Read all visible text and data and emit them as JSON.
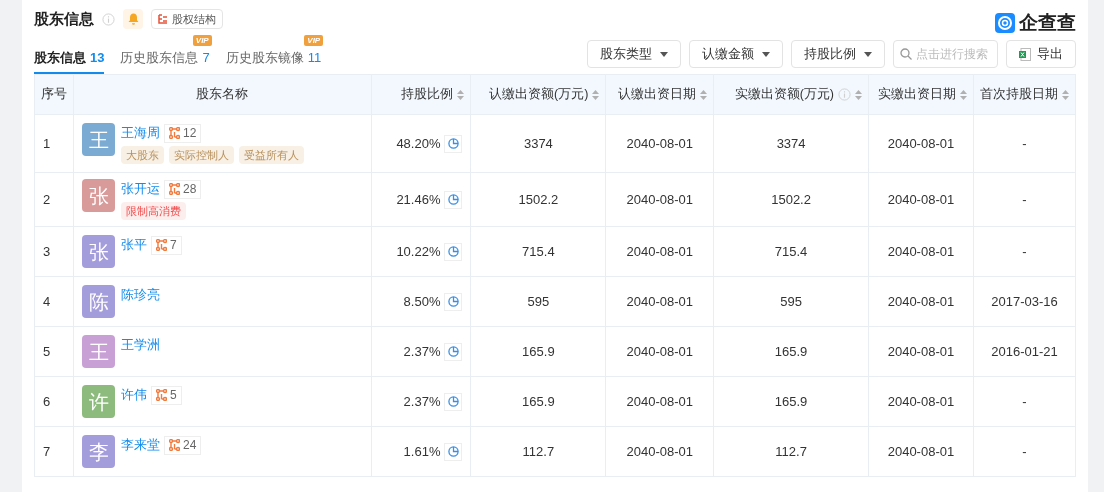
{
  "section": {
    "title": "股东信息",
    "equity_button": "股权结构"
  },
  "brand": {
    "name": "企查查"
  },
  "tabs": [
    {
      "label": "股东信息",
      "count": "13",
      "selected": true
    },
    {
      "label": "历史股东信息",
      "count": "7",
      "vip": "VIP",
      "selected": false
    },
    {
      "label": "历史股东镜像",
      "count": "11",
      "vip": "VIP",
      "selected": false
    }
  ],
  "filters": [
    "股东类型",
    "认缴金额",
    "持股比例"
  ],
  "search": {
    "placeholder": "点击进行搜索"
  },
  "export_button": "导出",
  "table": {
    "columns": [
      {
        "label": "序号",
        "sortable": false,
        "info": false
      },
      {
        "label": "股东名称",
        "sortable": false,
        "info": false
      },
      {
        "label": "持股比例",
        "sortable": true,
        "info": false
      },
      {
        "label": "认缴出资额(万元)",
        "sortable": true,
        "info": false
      },
      {
        "label": "认缴出资日期",
        "sortable": true,
        "info": false
      },
      {
        "label": "实缴出资额(万元)",
        "sortable": true,
        "info": true
      },
      {
        "label": "实缴出资日期",
        "sortable": true,
        "info": false
      },
      {
        "label": "首次持股日期",
        "sortable": true,
        "info": false
      }
    ],
    "rows": [
      {
        "index": "1",
        "avatar": "王",
        "color": "#7baad3",
        "name": "王海周",
        "relations": "12",
        "tags": [
          {
            "label": "大股东",
            "kind": "role"
          },
          {
            "label": "实际控制人",
            "kind": "role"
          },
          {
            "label": "受益所有人",
            "kind": "role"
          }
        ],
        "ratio": "48.20%",
        "subscribed": "3374",
        "subscribed_date": "2040-08-01",
        "paid": "3374",
        "paid_date": "2040-08-01",
        "first_date": "-"
      },
      {
        "index": "2",
        "avatar": "张",
        "color": "#d99a9a",
        "name": "张开运",
        "relations": "28",
        "tags": [
          {
            "label": "限制高消费",
            "kind": "risk"
          }
        ],
        "ratio": "21.46%",
        "subscribed": "1502.2",
        "subscribed_date": "2040-08-01",
        "paid": "1502.2",
        "paid_date": "2040-08-01",
        "first_date": "-"
      },
      {
        "index": "3",
        "avatar": "张",
        "color": "#a49ddc",
        "name": "张平",
        "relations": "7",
        "tags": [],
        "ratio": "10.22%",
        "subscribed": "715.4",
        "subscribed_date": "2040-08-01",
        "paid": "715.4",
        "paid_date": "2040-08-01",
        "first_date": "-"
      },
      {
        "index": "4",
        "avatar": "陈",
        "color": "#a49ddc",
        "name": "陈珍亮",
        "tags": [],
        "ratio": "8.50%",
        "subscribed": "595",
        "subscribed_date": "2040-08-01",
        "paid": "595",
        "paid_date": "2040-08-01",
        "first_date": "2017-03-16"
      },
      {
        "index": "5",
        "avatar": "王",
        "color": "#c9a0d6",
        "name": "王学洲",
        "tags": [],
        "ratio": "2.37%",
        "subscribed": "165.9",
        "subscribed_date": "2040-08-01",
        "paid": "165.9",
        "paid_date": "2040-08-01",
        "first_date": "2016-01-21"
      },
      {
        "index": "6",
        "avatar": "许",
        "color": "#8dbb7e",
        "name": "许伟",
        "relations": "5",
        "tags": [],
        "ratio": "2.37%",
        "subscribed": "165.9",
        "subscribed_date": "2040-08-01",
        "paid": "165.9",
        "paid_date": "2040-08-01",
        "first_date": "-"
      },
      {
        "index": "7",
        "avatar": "李",
        "color": "#a49ddc",
        "name": "李来堂",
        "relations": "24",
        "tags": [],
        "ratio": "1.61%",
        "subscribed": "112.7",
        "subscribed_date": "2040-08-01",
        "paid": "112.7",
        "paid_date": "2040-08-01",
        "first_date": "-"
      }
    ]
  }
}
